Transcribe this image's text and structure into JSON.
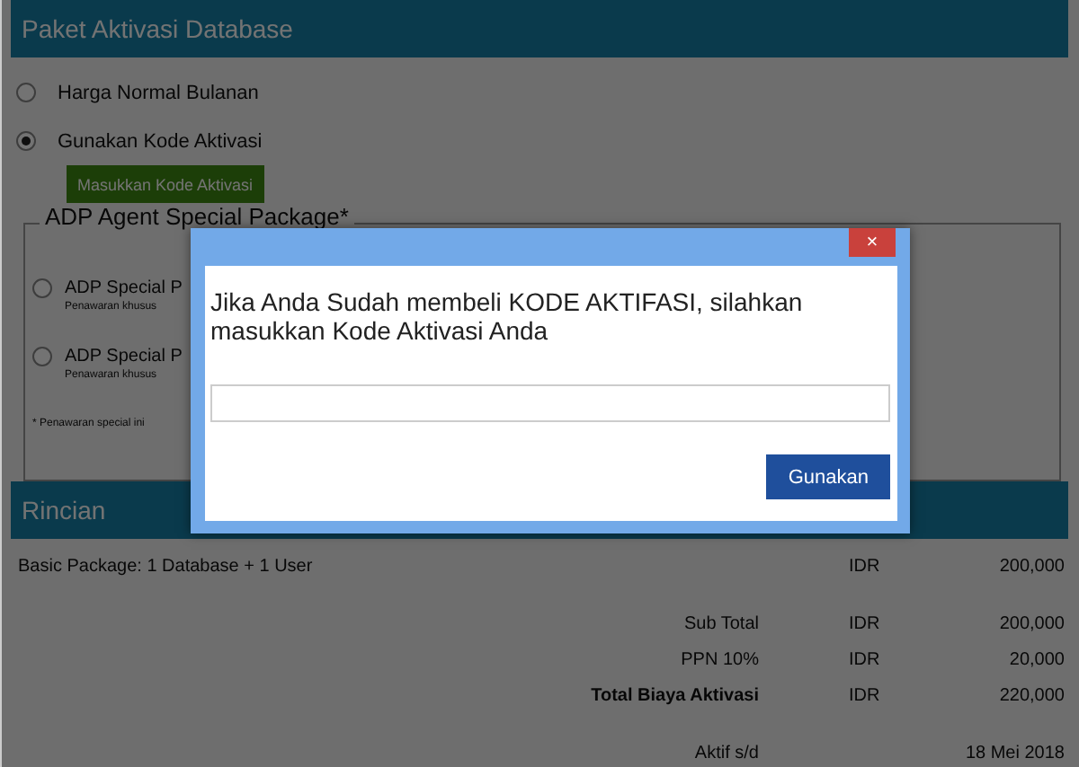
{
  "activation_panel": {
    "title": "Paket Aktivasi Database",
    "options": [
      {
        "label": "Harga Normal Bulanan",
        "selected": false
      },
      {
        "label": "Gunakan Kode Aktivasi",
        "selected": true
      }
    ],
    "enter_code_button": "Masukkan Kode Aktivasi",
    "special_package": {
      "legend": "ADP Agent Special Package*",
      "items": [
        {
          "title": "ADP Special P",
          "subtitle": "Penawaran khusus",
          "selected": false
        },
        {
          "title": "ADP Special P",
          "subtitle": "Penawaran khusus",
          "selected": false
        }
      ],
      "footnote": "* Penawaran special ini"
    }
  },
  "details_panel": {
    "title": "Rincian",
    "line_items": [
      {
        "label": "Basic Package: 1 Database + 1 User",
        "currency": "IDR",
        "amount": "200,000"
      }
    ],
    "summary": [
      {
        "label": "Sub Total",
        "currency": "IDR",
        "amount": "200,000",
        "bold": false
      },
      {
        "label": "PPN 10%",
        "currency": "IDR",
        "amount": "20,000",
        "bold": false
      },
      {
        "label": "Total Biaya Aktivasi",
        "currency": "IDR",
        "amount": "220,000",
        "bold": true
      }
    ],
    "active_until": {
      "label": "Aktif s/d",
      "value": "18 Mei 2018"
    }
  },
  "dialog": {
    "close": "×",
    "message": "Jika Anda Sudah membeli KODE AKTIFASI, silahkan masukkan Kode Aktivasi Anda",
    "button": "Gunakan"
  }
}
